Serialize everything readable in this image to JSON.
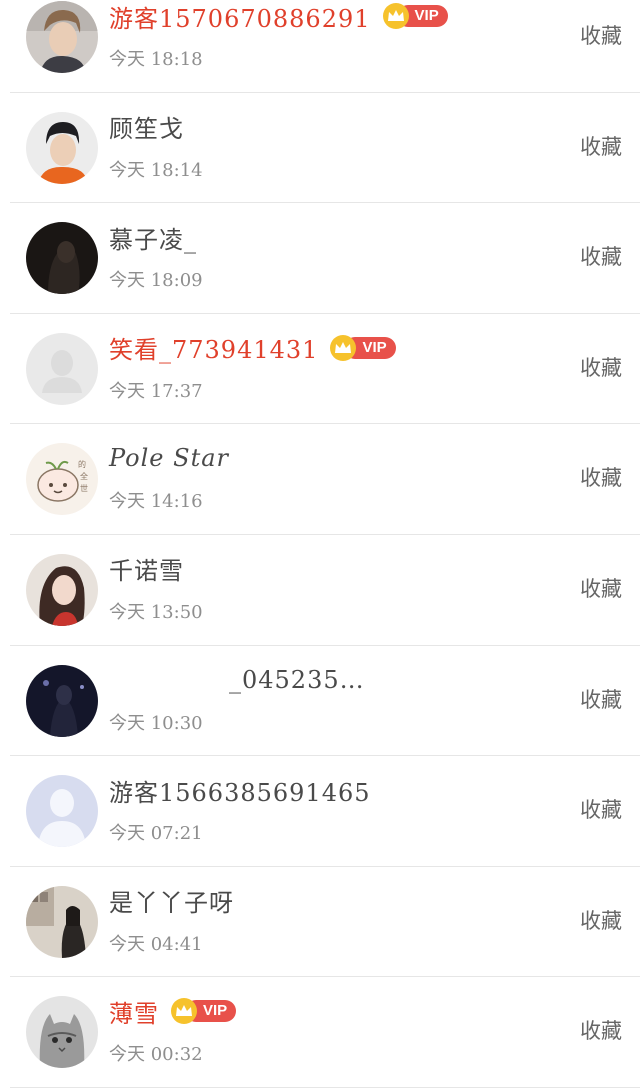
{
  "collect_label": "收藏",
  "vip_label": "VIP",
  "rows": [
    {
      "name": "游客1570670886291",
      "time": "今天 18:18",
      "vip": true
    },
    {
      "name": "顾笙戈",
      "time": "今天 18:14",
      "vip": false
    },
    {
      "name": "慕子凌_",
      "time": "今天 18:09",
      "vip": false
    },
    {
      "name": "笑看_773941431",
      "time": "今天 17:37",
      "vip": true
    },
    {
      "name": "Pole Star",
      "time": "今天 14:16",
      "vip": false
    },
    {
      "name": "千诺雪",
      "time": "今天 13:50",
      "vip": false
    },
    {
      "name": "_045235…",
      "time": "今天 10:30",
      "vip": false
    },
    {
      "name": "游客1566385691465",
      "time": "今天 07:21",
      "vip": false
    },
    {
      "name": "是丫丫子呀",
      "time": "今天 04:41",
      "vip": false
    },
    {
      "name": "薄雪",
      "time": "今天 00:32",
      "vip": true
    }
  ],
  "colors": {
    "vip_name": "#e0402b",
    "name": "#4a4a4a",
    "time": "#8e8e8e",
    "vip_badge": "#e8514a",
    "crown": "#f6c22c"
  }
}
